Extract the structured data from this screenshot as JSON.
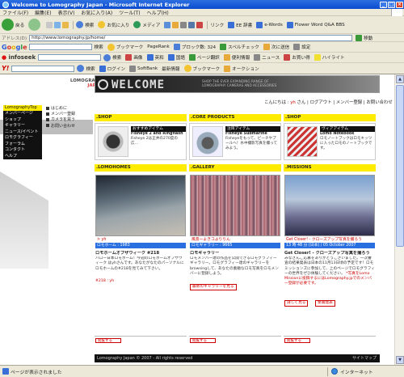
{
  "window": {
    "title": "Welcome to Lomography Japan - Microsoft Internet Explorer",
    "min": "_",
    "max": "□",
    "close": "×"
  },
  "menu": [
    "ファイル(F)",
    "編集(E)",
    "表示(V)",
    "お気に入り(A)",
    "ツール(T)",
    "ヘルプ(H)"
  ],
  "toolbar": {
    "back": "戻る",
    "search": "検索",
    "favorites": "お気に入り",
    "media": "メディア",
    "link": "リンク",
    "dictionary": "EE 辞書",
    "ewords": "e-Words",
    "flower": "Flower Word Q&A BBS"
  },
  "address": {
    "label": "アドレス(D)",
    "url": "http://www.lomography.jp/home/",
    "go": "移動"
  },
  "googlebar": {
    "search_btn": "検索",
    "bookmark": "ブックマーク",
    "pagerank": "PageRank",
    "blocked": "ブロック数: 324",
    "check": "スペルチェック",
    "next": "次に送信",
    "settings": "設定"
  },
  "infoseekbar": {
    "search": "検索",
    "image": "画像",
    "dictionary": "英和",
    "kokugo": "国語",
    "page_translate": "ページ翻訳",
    "transfer": "便利情報",
    "news": "ニュース",
    "fortune": "お買い得",
    "highlight": "ハイライト"
  },
  "yahoobar": {
    "search": "検索",
    "login": "ログイン",
    "softbank": "SoftBank",
    "newinfo": "最新情報",
    "bookmark": "ブックマーク",
    "auction": "オークション"
  },
  "page": {
    "logo_line1": "LOMOGRAPHY",
    "logo_line2": "JAPAN",
    "welcome": "WELCOME",
    "tagline": "SHOP THE EVER EXPANDING RANGE OF LOMOGRAPHY CAMERAS AND ACCESSORIES",
    "nav": [
      {
        "label": "LomographyTop",
        "active": true
      },
      {
        "label": "メンバーページ",
        "active": false
      },
      {
        "label": "ショップ",
        "active": false
      },
      {
        "label": "ギャラリー",
        "active": false
      },
      {
        "label": "ニュース/イベント",
        "active": false
      },
      {
        "label": "ロモグラフィー",
        "active": false
      },
      {
        "label": "フォーラム",
        "active": false
      },
      {
        "label": "コンタクト",
        "active": false
      },
      {
        "label": "ヘルプ",
        "active": false
      }
    ],
    "subnav": [
      "はじめに",
      "メンバー登録",
      "カメラを買う",
      "お問い合わせ"
    ],
    "user": {
      "greeting": "こんにちは :",
      "name": "yh",
      "suffix": "さん",
      "logout": "ログアウト",
      "member": "メンバー登録",
      "contact": "お問い合わせ"
    },
    "sections_top": [
      {
        "head": ".SHOP",
        "tag": "おすすめアイテム",
        "title": "Fisheye 2 and Ringflash",
        "desc": "Fisheye 2は正井の270度の広..."
      },
      {
        "head": ".CORE PRODUCTS",
        "tag": "注目アイテム",
        "title": "Fisheye Submarine",
        "desc": "Fisheyeをもって、ビーチやプールへ！水中撮影写真を撮ってみよう。"
      },
      {
        "head": ".SHOP",
        "tag": "ヴィアアイテム",
        "title": "Lomo Notebook",
        "desc": "ロモノートブックはロモキッツに入ったロモのノートブックです。"
      }
    ],
    "sections_main": [
      {
        "head": ".LOMOHOMES",
        "user": "> yh",
        "meta": "ロモホーム : 1983",
        "title": "ロモホームオブザウィーク #218",
        "body": "ハロー日本ロモホーム！今週のロモホームオブザウィーク はyhさんです。あなたがなたのパーソナルにロモホームの#218を見てみて下さい。",
        "link": "#218 : yh"
      },
      {
        "head": ".GALLERY",
        "user": "風景一よきコよりりん",
        "meta": "ロモギャラリー : 9665",
        "title": "ロモギャラリー",
        "body": "ロモメンバー達の作品を公開できるロモグラフィーギャラリー。ロモグラフィー達のギャラリーをbrowsingして、あなたの素敵なロモ写真をロモメンバーに登録しよう。",
        "link": "最新のギャラリーを見る"
      },
      {
        "head": ".MISSIONS",
        "user": "Get Closer! - クローズアップ写真を撮ろう",
        "meta": "13 時 48 分 (日本) / 05 October 2007",
        "title": "Get Closer! - クローズアップ写真を撮ろう",
        "body": "みなさんご応募をありがとうございました。一次審査の結果発表は日本の11月13日頃の予定です！ロモミッションズに参加して、上のページでロモグラフィーの世界をぜひ体験してください。",
        "body_red": "*写真をLomo Missionに投稿するにはLomography.jpでのメンバー登録が必要です。",
        "link": "詳しく見る",
        "link2": "受賞発表"
      }
    ],
    "more_labels": [
      "閲覧する",
      "閲覧する",
      "閲覧する"
    ],
    "footer_left": "Lomography Japan © 2007 - All rights reserved",
    "footer_right": "サイトマップ"
  },
  "status": {
    "text": "ページが表示されました",
    "zone": "インターネット"
  }
}
